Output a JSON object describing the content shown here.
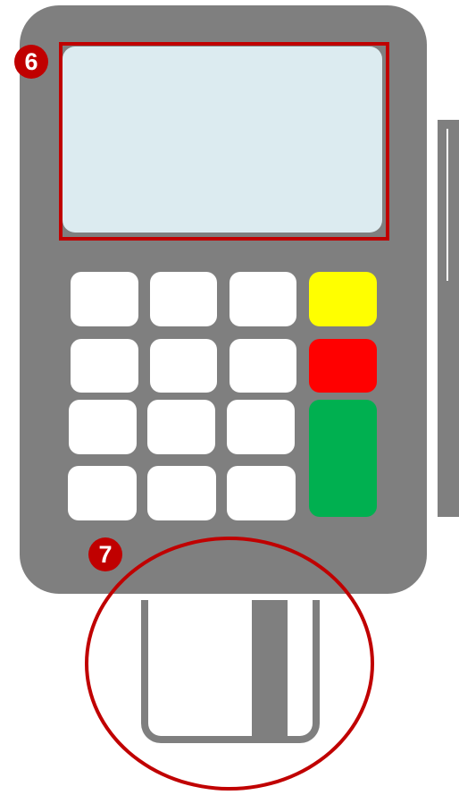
{
  "colors": {
    "device_body": "#7f7f7f",
    "screen": "#dcebf0",
    "highlight": "#c00000",
    "key_number": "#ffffff",
    "key_yellow": "#ffff00",
    "key_red": "#ff0000",
    "key_green": "#00b050"
  },
  "callouts": {
    "screen_badge": "6",
    "card_reader_badge": "7"
  },
  "keypad": {
    "number_keys": 12,
    "function_keys": [
      "yellow",
      "red",
      "green"
    ]
  }
}
